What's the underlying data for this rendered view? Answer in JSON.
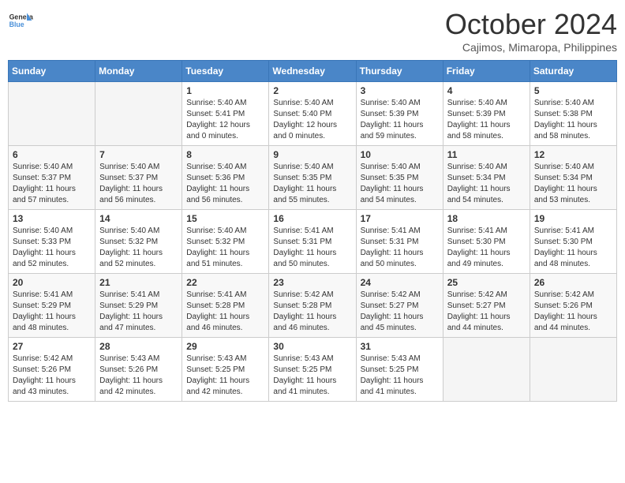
{
  "header": {
    "logo_general": "General",
    "logo_blue": "Blue",
    "month_title": "October 2024",
    "location": "Cajimos, Mimaropa, Philippines"
  },
  "days_of_week": [
    "Sunday",
    "Monday",
    "Tuesday",
    "Wednesday",
    "Thursday",
    "Friday",
    "Saturday"
  ],
  "weeks": [
    [
      {
        "day": "",
        "info": ""
      },
      {
        "day": "",
        "info": ""
      },
      {
        "day": "1",
        "info": "Sunrise: 5:40 AM\nSunset: 5:41 PM\nDaylight: 12 hours and 0 minutes."
      },
      {
        "day": "2",
        "info": "Sunrise: 5:40 AM\nSunset: 5:40 PM\nDaylight: 12 hours and 0 minutes."
      },
      {
        "day": "3",
        "info": "Sunrise: 5:40 AM\nSunset: 5:39 PM\nDaylight: 11 hours and 59 minutes."
      },
      {
        "day": "4",
        "info": "Sunrise: 5:40 AM\nSunset: 5:39 PM\nDaylight: 11 hours and 58 minutes."
      },
      {
        "day": "5",
        "info": "Sunrise: 5:40 AM\nSunset: 5:38 PM\nDaylight: 11 hours and 58 minutes."
      }
    ],
    [
      {
        "day": "6",
        "info": "Sunrise: 5:40 AM\nSunset: 5:37 PM\nDaylight: 11 hours and 57 minutes."
      },
      {
        "day": "7",
        "info": "Sunrise: 5:40 AM\nSunset: 5:37 PM\nDaylight: 11 hours and 56 minutes."
      },
      {
        "day": "8",
        "info": "Sunrise: 5:40 AM\nSunset: 5:36 PM\nDaylight: 11 hours and 56 minutes."
      },
      {
        "day": "9",
        "info": "Sunrise: 5:40 AM\nSunset: 5:35 PM\nDaylight: 11 hours and 55 minutes."
      },
      {
        "day": "10",
        "info": "Sunrise: 5:40 AM\nSunset: 5:35 PM\nDaylight: 11 hours and 54 minutes."
      },
      {
        "day": "11",
        "info": "Sunrise: 5:40 AM\nSunset: 5:34 PM\nDaylight: 11 hours and 54 minutes."
      },
      {
        "day": "12",
        "info": "Sunrise: 5:40 AM\nSunset: 5:34 PM\nDaylight: 11 hours and 53 minutes."
      }
    ],
    [
      {
        "day": "13",
        "info": "Sunrise: 5:40 AM\nSunset: 5:33 PM\nDaylight: 11 hours and 52 minutes."
      },
      {
        "day": "14",
        "info": "Sunrise: 5:40 AM\nSunset: 5:32 PM\nDaylight: 11 hours and 52 minutes."
      },
      {
        "day": "15",
        "info": "Sunrise: 5:40 AM\nSunset: 5:32 PM\nDaylight: 11 hours and 51 minutes."
      },
      {
        "day": "16",
        "info": "Sunrise: 5:41 AM\nSunset: 5:31 PM\nDaylight: 11 hours and 50 minutes."
      },
      {
        "day": "17",
        "info": "Sunrise: 5:41 AM\nSunset: 5:31 PM\nDaylight: 11 hours and 50 minutes."
      },
      {
        "day": "18",
        "info": "Sunrise: 5:41 AM\nSunset: 5:30 PM\nDaylight: 11 hours and 49 minutes."
      },
      {
        "day": "19",
        "info": "Sunrise: 5:41 AM\nSunset: 5:30 PM\nDaylight: 11 hours and 48 minutes."
      }
    ],
    [
      {
        "day": "20",
        "info": "Sunrise: 5:41 AM\nSunset: 5:29 PM\nDaylight: 11 hours and 48 minutes."
      },
      {
        "day": "21",
        "info": "Sunrise: 5:41 AM\nSunset: 5:29 PM\nDaylight: 11 hours and 47 minutes."
      },
      {
        "day": "22",
        "info": "Sunrise: 5:41 AM\nSunset: 5:28 PM\nDaylight: 11 hours and 46 minutes."
      },
      {
        "day": "23",
        "info": "Sunrise: 5:42 AM\nSunset: 5:28 PM\nDaylight: 11 hours and 46 minutes."
      },
      {
        "day": "24",
        "info": "Sunrise: 5:42 AM\nSunset: 5:27 PM\nDaylight: 11 hours and 45 minutes."
      },
      {
        "day": "25",
        "info": "Sunrise: 5:42 AM\nSunset: 5:27 PM\nDaylight: 11 hours and 44 minutes."
      },
      {
        "day": "26",
        "info": "Sunrise: 5:42 AM\nSunset: 5:26 PM\nDaylight: 11 hours and 44 minutes."
      }
    ],
    [
      {
        "day": "27",
        "info": "Sunrise: 5:42 AM\nSunset: 5:26 PM\nDaylight: 11 hours and 43 minutes."
      },
      {
        "day": "28",
        "info": "Sunrise: 5:43 AM\nSunset: 5:26 PM\nDaylight: 11 hours and 42 minutes."
      },
      {
        "day": "29",
        "info": "Sunrise: 5:43 AM\nSunset: 5:25 PM\nDaylight: 11 hours and 42 minutes."
      },
      {
        "day": "30",
        "info": "Sunrise: 5:43 AM\nSunset: 5:25 PM\nDaylight: 11 hours and 41 minutes."
      },
      {
        "day": "31",
        "info": "Sunrise: 5:43 AM\nSunset: 5:25 PM\nDaylight: 11 hours and 41 minutes."
      },
      {
        "day": "",
        "info": ""
      },
      {
        "day": "",
        "info": ""
      }
    ]
  ]
}
